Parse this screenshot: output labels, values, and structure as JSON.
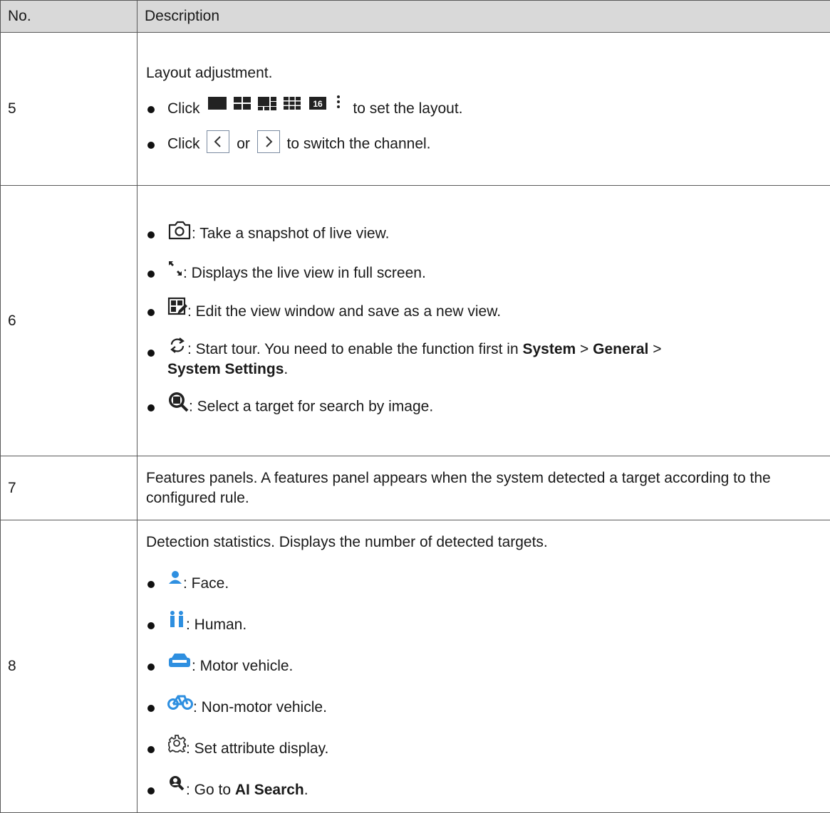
{
  "header": {
    "col_no": "No.",
    "col_desc": "Description"
  },
  "rows": {
    "r5": {
      "no": "5",
      "intro": "Layout adjustment.",
      "b1_click": "Click",
      "b1_text": "to set the layout.",
      "b2_click": "Click",
      "b2_or": "or",
      "b2_text": "to switch the channel."
    },
    "r6": {
      "no": "6",
      "snapshot": ": Take a snapshot of live view.",
      "fullscreen": ": Displays the live view in full screen.",
      "edit": ": Edit the view window and save as a new view.",
      "tour_pre": ": Start tour. You need to enable the function first in",
      "tour_system": "System",
      "tour_sep1": " > ",
      "tour_general": "General",
      "tour_sep2": " > ",
      "tour_settings": "System Settings",
      "tour_end": ".",
      "search": ": Select a target for search by image."
    },
    "r7": {
      "no": "7",
      "text": "Features panels. A features panel appears when the system detected a target according to the configured rule."
    },
    "r8": {
      "no": "8",
      "intro": "Detection statistics. Displays the number of detected targets.",
      "face": ": Face.",
      "human": ": Human.",
      "motor": ": Motor vehicle.",
      "nonmotor": ": Non-motor vehicle.",
      "attribute": ": Set attribute display.",
      "ai_pre": ": Go to ",
      "ai_link": "AI Search",
      "ai_end": "."
    }
  },
  "icons": {
    "layout_icons": [
      "layout-1-icon",
      "layout-4-icon",
      "layout-6-icon",
      "layout-9-icon",
      "layout-16-icon",
      "more-vertical-icon"
    ],
    "layout_16_label": "16",
    "prev_icon": "chevron-left-icon",
    "next_icon": "chevron-right-icon",
    "accent_blue": "#2e8fe0"
  }
}
